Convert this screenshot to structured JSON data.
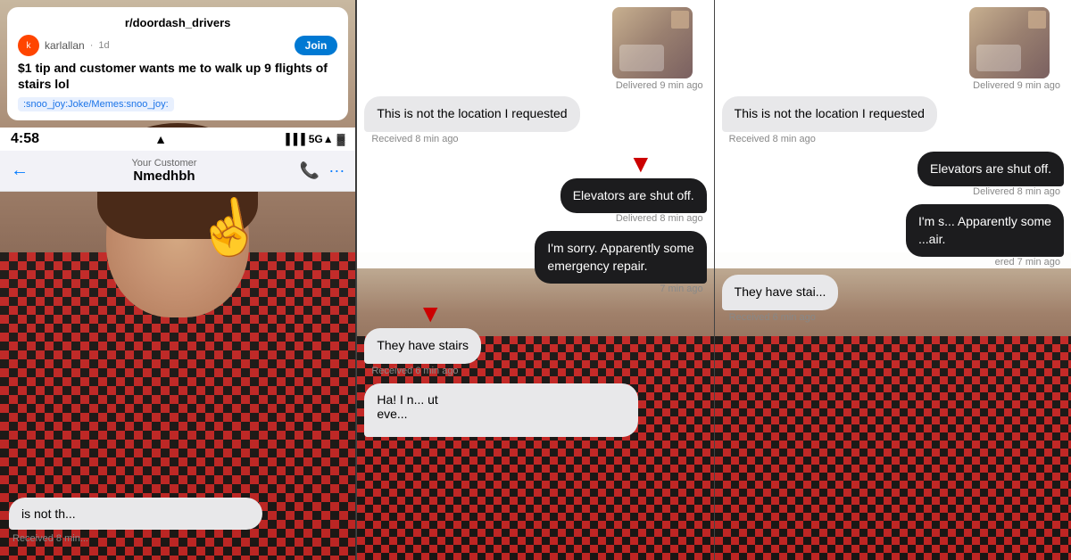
{
  "panel1": {
    "reddit": {
      "subreddit": "r/doordash_drivers",
      "username": "karlallan",
      "time_ago": "1d",
      "join_label": "Join",
      "title": "$1 tip and customer wants me to walk up 9 flights of stairs lol",
      "tag": ":snoo_joy:Joke/Memes:snoo_joy:"
    },
    "status_bar": {
      "time": "4:58",
      "signal": "5G▲"
    },
    "nav": {
      "back": "←",
      "title": "Your Customer",
      "name": "Nmedhbh"
    },
    "chat_bottom": {
      "message": "is not th...",
      "time": "Received 8 min..."
    }
  },
  "panel2": {
    "thumbnail_label": "Delivered 9 min ago",
    "msg1": {
      "text": "This is not the location I requested",
      "time": "Received 8 min ago"
    },
    "msg2": {
      "text": "Elevators are shut off.",
      "time": "Delivered 8 min ago"
    },
    "msg3_line1": "I'm sorry. Apparently some",
    "msg3_line2": "emergency repair.",
    "msg3_time": "7 min ago",
    "msg4": {
      "text": "They have stairs",
      "time": "Received 6 min ago"
    },
    "msg5_partial": "Ha! I n... ut\neve...",
    "arrow1_label": "red arrow down",
    "arrow2_label": "red arrow down"
  },
  "panel3": {
    "thumbnail_label": "Delivered 9 min ago",
    "msg1": {
      "text": "This is not the location I requested",
      "time": "Received 8 min ago"
    },
    "msg2": {
      "text": "Elevators are shut off.",
      "time": "Delivered 8 min ago"
    },
    "msg3_partial": "I'm s... Apparently some\n...air.",
    "msg3_time": "ered 7 min ago",
    "msg4": {
      "text": "They have stai...",
      "time": "Received 6 min ago"
    }
  }
}
